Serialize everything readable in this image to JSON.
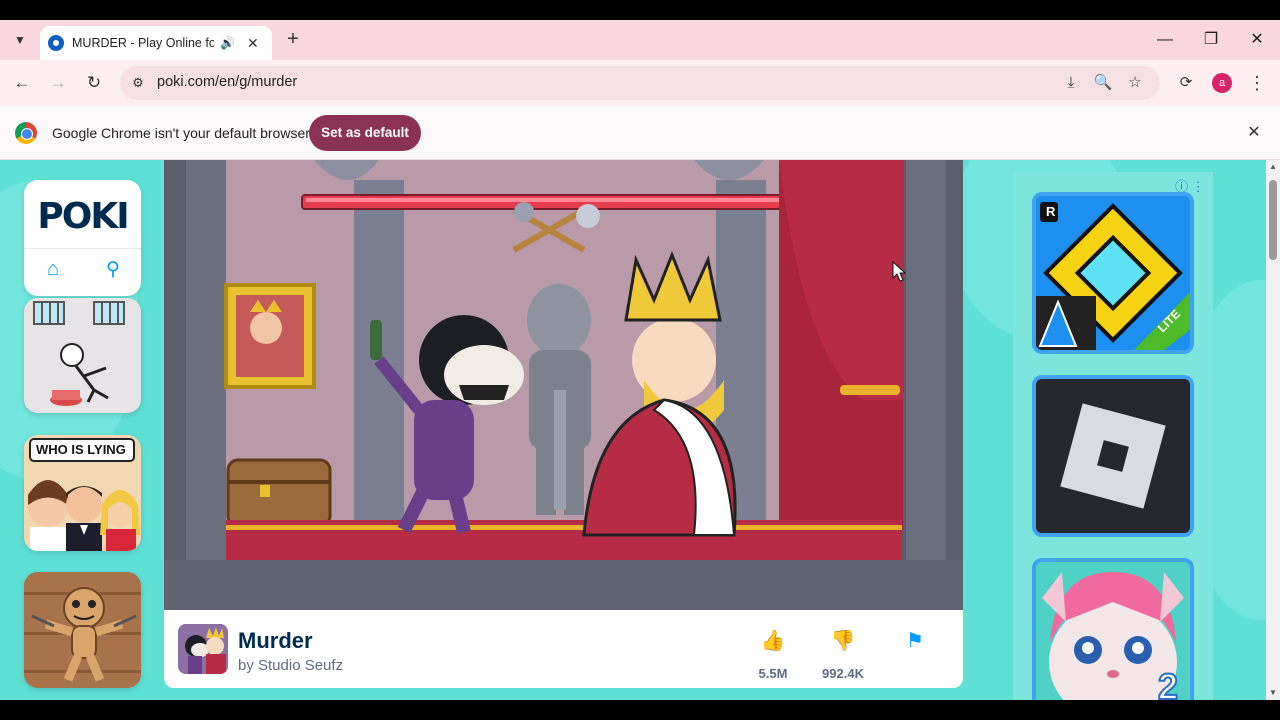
{
  "browser": {
    "tab_title": "MURDER - Play Online for F",
    "new_tab_symbol": "+",
    "url": "poki.com/en/g/murder",
    "avatar_letter": "a"
  },
  "infobar": {
    "message": "Google Chrome isn't your default browser",
    "button_label": "Set as default"
  },
  "sidebar": {
    "logo": "POKI",
    "thumbnails": [
      {
        "name": "prison-escape"
      },
      {
        "name": "who-is-lying",
        "caption": "WHO IS LYING"
      },
      {
        "name": "voodoo-doll"
      }
    ]
  },
  "game": {
    "title": "Murder",
    "author": "by Studio Seufz",
    "likes": "5.5M",
    "dislikes": "992.4K"
  },
  "ads": {
    "tiles": [
      {
        "name": "geometry-dash-lite",
        "badge": "R",
        "tag": "LITE"
      },
      {
        "name": "roblox"
      },
      {
        "name": "talking-angela-2",
        "number": "2"
      }
    ]
  }
}
